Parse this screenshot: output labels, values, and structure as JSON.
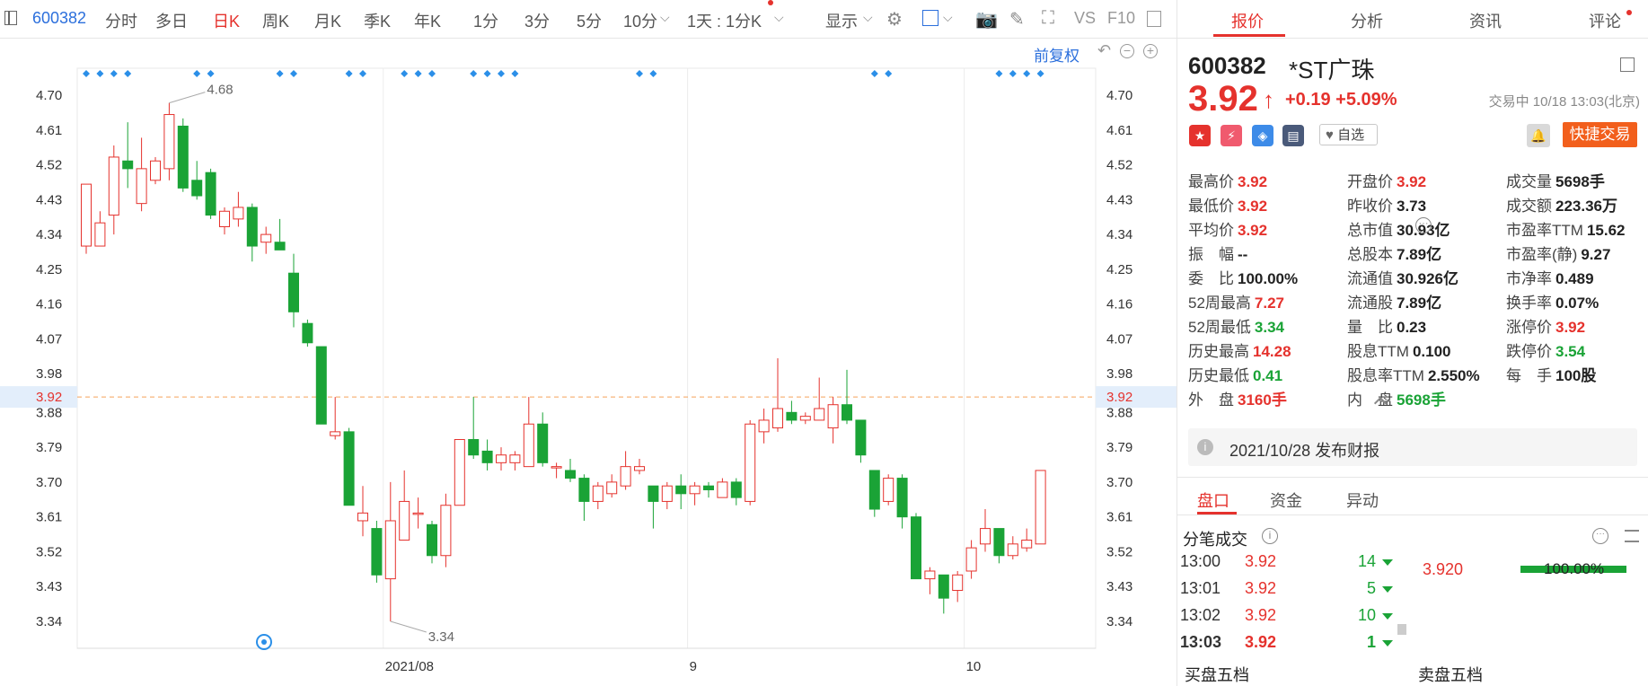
{
  "toolbar": {
    "code": "600382",
    "tabs": [
      "分时",
      "多日",
      "日K",
      "周K",
      "月K",
      "季K",
      "年K",
      "1分",
      "3分",
      "5分",
      "10分"
    ],
    "active_tab": "日K",
    "interval_select": "1天 : 1分K",
    "display_label": "显示",
    "text_icons": [
      "VS",
      "F10"
    ],
    "icons": [
      "sidebar-toggle-icon",
      "chevron-down-icon",
      "gear-icon",
      "square-icon",
      "camera-icon",
      "pencil-icon",
      "fullscreen-icon",
      "panel-icon"
    ],
    "accent": "#e5322d"
  },
  "chart": {
    "restore_label": "前复权",
    "icons": [
      "undo-icon",
      "zoom-out-icon",
      "zoom-in-icon"
    ],
    "y_ticks": [
      4.7,
      4.61,
      4.52,
      4.43,
      4.34,
      4.25,
      4.16,
      4.07,
      3.98,
      3.88,
      3.79,
      3.7,
      3.61,
      3.52,
      3.43,
      3.34
    ],
    "x_labels": [
      {
        "index": 22,
        "label": "2021/08"
      },
      {
        "index": 44,
        "label": "9"
      },
      {
        "index": 64,
        "label": "10"
      }
    ],
    "current_price_label": "3.92",
    "current_price": 3.92,
    "max_label": {
      "index": 6,
      "value": "4.68"
    },
    "min_label": {
      "index": 22,
      "value": "3.34"
    },
    "up_color": "#e5322d",
    "down_color": "#1aa336",
    "marker_color": "#2b8fe8",
    "event_markers": [
      0,
      1,
      2,
      3,
      8,
      9,
      14,
      15,
      19,
      20,
      23,
      24,
      25,
      28,
      29,
      30,
      31,
      40,
      41,
      57,
      58,
      66,
      67,
      68,
      69
    ]
  },
  "chart_data": {
    "type": "candlestick",
    "ylim": [
      3.3,
      4.74
    ],
    "candles": [
      {
        "o": 4.31,
        "c": 4.47,
        "h": 4.47,
        "l": 4.29
      },
      {
        "o": 4.31,
        "c": 4.37,
        "h": 4.4,
        "l": 4.31
      },
      {
        "o": 4.39,
        "c": 4.54,
        "h": 4.57,
        "l": 4.34
      },
      {
        "o": 4.53,
        "c": 4.51,
        "h": 4.63,
        "l": 4.46
      },
      {
        "o": 4.42,
        "c": 4.51,
        "h": 4.59,
        "l": 4.4
      },
      {
        "o": 4.48,
        "c": 4.53,
        "h": 4.54,
        "l": 4.47
      },
      {
        "o": 4.51,
        "c": 4.65,
        "h": 4.68,
        "l": 4.48
      },
      {
        "o": 4.62,
        "c": 4.46,
        "h": 4.64,
        "l": 4.45
      },
      {
        "o": 4.48,
        "c": 4.44,
        "h": 4.53,
        "l": 4.43
      },
      {
        "o": 4.5,
        "c": 4.39,
        "h": 4.51,
        "l": 4.38
      },
      {
        "o": 4.36,
        "c": 4.4,
        "h": 4.41,
        "l": 4.34
      },
      {
        "o": 4.38,
        "c": 4.41,
        "h": 4.45,
        "l": 4.36
      },
      {
        "o": 4.41,
        "c": 4.31,
        "h": 4.42,
        "l": 4.27
      },
      {
        "o": 4.32,
        "c": 4.34,
        "h": 4.36,
        "l": 4.29
      },
      {
        "o": 4.32,
        "c": 4.3,
        "h": 4.38,
        "l": 4.3
      },
      {
        "o": 4.24,
        "c": 4.14,
        "h": 4.29,
        "l": 4.1
      },
      {
        "o": 4.11,
        "c": 4.06,
        "h": 4.12,
        "l": 4.05
      },
      {
        "o": 4.05,
        "c": 3.85,
        "h": 4.05,
        "l": 3.85
      },
      {
        "o": 3.82,
        "c": 3.83,
        "h": 3.92,
        "l": 3.81
      },
      {
        "o": 3.83,
        "c": 3.64,
        "h": 3.84,
        "l": 3.64
      },
      {
        "o": 3.6,
        "c": 3.62,
        "h": 3.69,
        "l": 3.56
      },
      {
        "o": 3.58,
        "c": 3.46,
        "h": 3.6,
        "l": 3.44
      },
      {
        "o": 3.45,
        "c": 3.6,
        "h": 3.7,
        "l": 3.34
      },
      {
        "o": 3.55,
        "c": 3.65,
        "h": 3.73,
        "l": 3.55
      },
      {
        "o": 3.62,
        "c": 3.62,
        "h": 3.66,
        "l": 3.58
      },
      {
        "o": 3.59,
        "c": 3.51,
        "h": 3.6,
        "l": 3.49
      },
      {
        "o": 3.51,
        "c": 3.64,
        "h": 3.67,
        "l": 3.48
      },
      {
        "o": 3.64,
        "c": 3.81,
        "h": 3.81,
        "l": 3.64
      },
      {
        "o": 3.81,
        "c": 3.77,
        "h": 3.92,
        "l": 3.76
      },
      {
        "o": 3.78,
        "c": 3.75,
        "h": 3.81,
        "l": 3.73
      },
      {
        "o": 3.75,
        "c": 3.77,
        "h": 3.79,
        "l": 3.73
      },
      {
        "o": 3.75,
        "c": 3.77,
        "h": 3.78,
        "l": 3.73
      },
      {
        "o": 3.74,
        "c": 3.85,
        "h": 3.92,
        "l": 3.74
      },
      {
        "o": 3.85,
        "c": 3.75,
        "h": 3.88,
        "l": 3.74
      },
      {
        "o": 3.74,
        "c": 3.74,
        "h": 3.75,
        "l": 3.71
      },
      {
        "o": 3.73,
        "c": 3.71,
        "h": 3.76,
        "l": 3.7
      },
      {
        "o": 3.71,
        "c": 3.65,
        "h": 3.72,
        "l": 3.6
      },
      {
        "o": 3.65,
        "c": 3.69,
        "h": 3.7,
        "l": 3.63
      },
      {
        "o": 3.67,
        "c": 3.7,
        "h": 3.72,
        "l": 3.66
      },
      {
        "o": 3.69,
        "c": 3.74,
        "h": 3.78,
        "l": 3.68
      },
      {
        "o": 3.73,
        "c": 3.74,
        "h": 3.76,
        "l": 3.72
      },
      {
        "o": 3.69,
        "c": 3.65,
        "h": 3.69,
        "l": 3.58
      },
      {
        "o": 3.65,
        "c": 3.69,
        "h": 3.7,
        "l": 3.63
      },
      {
        "o": 3.69,
        "c": 3.67,
        "h": 3.72,
        "l": 3.63
      },
      {
        "o": 3.67,
        "c": 3.69,
        "h": 3.7,
        "l": 3.64
      },
      {
        "o": 3.69,
        "c": 3.68,
        "h": 3.7,
        "l": 3.66
      },
      {
        "o": 3.66,
        "c": 3.7,
        "h": 3.71,
        "l": 3.66
      },
      {
        "o": 3.7,
        "c": 3.66,
        "h": 3.71,
        "l": 3.64
      },
      {
        "o": 3.65,
        "c": 3.85,
        "h": 3.86,
        "l": 3.64
      },
      {
        "o": 3.83,
        "c": 3.86,
        "h": 3.89,
        "l": 3.8
      },
      {
        "o": 3.84,
        "c": 3.89,
        "h": 4.02,
        "l": 3.83
      },
      {
        "o": 3.88,
        "c": 3.86,
        "h": 3.91,
        "l": 3.85
      },
      {
        "o": 3.86,
        "c": 3.87,
        "h": 3.88,
        "l": 3.85
      },
      {
        "o": 3.86,
        "c": 3.89,
        "h": 3.97,
        "l": 3.86
      },
      {
        "o": 3.84,
        "c": 3.9,
        "h": 3.92,
        "l": 3.8
      },
      {
        "o": 3.9,
        "c": 3.86,
        "h": 3.99,
        "l": 3.85
      },
      {
        "o": 3.86,
        "c": 3.77,
        "h": 3.86,
        "l": 3.75
      },
      {
        "o": 3.73,
        "c": 3.63,
        "h": 3.73,
        "l": 3.61
      },
      {
        "o": 3.65,
        "c": 3.71,
        "h": 3.72,
        "l": 3.64
      },
      {
        "o": 3.71,
        "c": 3.61,
        "h": 3.72,
        "l": 3.58
      },
      {
        "o": 3.61,
        "c": 3.45,
        "h": 3.62,
        "l": 3.45
      },
      {
        "o": 3.45,
        "c": 3.47,
        "h": 3.48,
        "l": 3.41
      },
      {
        "o": 3.46,
        "c": 3.4,
        "h": 3.46,
        "l": 3.36
      },
      {
        "o": 3.42,
        "c": 3.46,
        "h": 3.47,
        "l": 3.39
      },
      {
        "o": 3.47,
        "c": 3.53,
        "h": 3.55,
        "l": 3.45
      },
      {
        "o": 3.54,
        "c": 3.58,
        "h": 3.63,
        "l": 3.52
      },
      {
        "o": 3.58,
        "c": 3.51,
        "h": 3.58,
        "l": 3.49
      },
      {
        "o": 3.51,
        "c": 3.54,
        "h": 3.56,
        "l": 3.5
      },
      {
        "o": 3.53,
        "c": 3.55,
        "h": 3.58,
        "l": 3.52
      },
      {
        "o": 3.54,
        "c": 3.73,
        "h": 3.73,
        "l": 3.54
      }
    ]
  },
  "quote": {
    "code": "600382",
    "name": "*ST广珠",
    "price": "3.92",
    "change": "+0.19",
    "change_pct": "+5.09%",
    "status": "交易中 10/18 13:03(北京)",
    "watch_label": "自选",
    "trade_label": "快捷交易",
    "chips": [
      {
        "name": "china-flag-icon",
        "glyph": "★",
        "color": "#e5322d"
      },
      {
        "name": "lightning-icon",
        "glyph": "⚡",
        "color": "#f05a6e"
      },
      {
        "name": "tag-icon",
        "glyph": "◈",
        "color": "#3d8be8"
      },
      {
        "name": "note-icon",
        "glyph": "▤",
        "color": "#4a5a7a"
      }
    ]
  },
  "right_tabs": [
    "报价",
    "分析",
    "资讯",
    "评论"
  ],
  "stats": [
    [
      {
        "label": "最高价",
        "value": "3.92",
        "color": "red"
      },
      {
        "label": "开盘价",
        "value": "3.92",
        "color": "red"
      },
      {
        "label": "成交量",
        "value": "5698手",
        "color": ""
      }
    ],
    [
      {
        "label": "最低价",
        "value": "3.92",
        "color": "red"
      },
      {
        "label": "昨收价",
        "value": "3.73",
        "color": ""
      },
      {
        "label": "成交额",
        "value": "223.36万",
        "color": ""
      }
    ],
    [
      {
        "label": "平均价",
        "value": "3.92",
        "color": "red"
      },
      {
        "label": "总市值",
        "value": "30.93亿",
        "color": ""
      },
      {
        "label": "市盈率TTM",
        "value": "15.62",
        "color": ""
      }
    ],
    [
      {
        "label": "振　幅",
        "value": "--",
        "color": ""
      },
      {
        "label": "总股本",
        "value": "7.89亿",
        "color": ""
      },
      {
        "label": "市盈率(静)",
        "value": "9.27",
        "color": ""
      }
    ],
    [
      {
        "label": "委　比",
        "value": "100.00%",
        "color": ""
      },
      {
        "label": "流通值",
        "value": "30.926亿",
        "color": ""
      },
      {
        "label": "市净率",
        "value": "0.489",
        "color": ""
      }
    ],
    [
      {
        "label": "52周最高",
        "value": "7.27",
        "color": "red"
      },
      {
        "label": "流通股",
        "value": "7.89亿",
        "color": ""
      },
      {
        "label": "换手率",
        "value": "0.07%",
        "color": ""
      }
    ],
    [
      {
        "label": "52周最低",
        "value": "3.34",
        "color": "green"
      },
      {
        "label": "量　比",
        "value": "0.23",
        "color": ""
      },
      {
        "label": "涨停价",
        "value": "3.92",
        "color": "red"
      }
    ],
    [
      {
        "label": "历史最高",
        "value": "14.28",
        "color": "red"
      },
      {
        "label": "股息TTM",
        "value": "0.100",
        "color": ""
      },
      {
        "label": "跌停价",
        "value": "3.54",
        "color": "green"
      }
    ],
    [
      {
        "label": "历史最低",
        "value": "0.41",
        "color": "green"
      },
      {
        "label": "股息率TTM",
        "value": "2.550%",
        "color": ""
      },
      {
        "label": "每　手",
        "value": "100股",
        "color": ""
      }
    ],
    [
      {
        "label": "外　盘",
        "value": "3160手",
        "color": "red"
      },
      {
        "label": "内　盘",
        "value": "5698手",
        "color": "green"
      },
      {
        "label": "",
        "value": "",
        "color": ""
      }
    ]
  ],
  "notice": {
    "text": "2021/10/28  发布财报"
  },
  "sub_tabs": [
    "盘口",
    "资金",
    "异动"
  ],
  "ticks": {
    "title": "分笔成交",
    "rows": [
      {
        "time": "13:00",
        "price": "3.92",
        "vol": "14"
      },
      {
        "time": "13:01",
        "price": "3.92",
        "vol": "5"
      },
      {
        "time": "13:02",
        "price": "3.92",
        "vol": "10"
      },
      {
        "time": "13:03",
        "price": "3.92",
        "vol": "1"
      }
    ],
    "dist_price": "3.920",
    "dist_pct": "100.00%"
  },
  "order_book": {
    "bid_title": "买盘五档",
    "ask_title": "卖盘五档"
  }
}
